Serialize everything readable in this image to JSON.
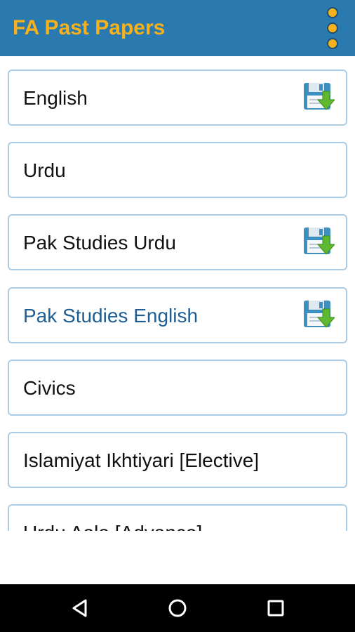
{
  "app": {
    "title": "FA Past Papers"
  },
  "appbar": {
    "menu_icon": "more-vert-icon",
    "accent": "#f7b21b",
    "background": "#2a7ab0"
  },
  "list": {
    "items": [
      {
        "label": "English",
        "downloaded": true,
        "icon": "save-download-icon"
      },
      {
        "label": "Urdu",
        "downloaded": false
      },
      {
        "label": "Pak Studies Urdu",
        "downloaded": true,
        "icon": "save-download-icon"
      },
      {
        "label": "Pak Studies English",
        "downloaded": true,
        "icon": "save-download-icon",
        "highlighted": true
      },
      {
        "label": "Civics",
        "downloaded": false
      },
      {
        "label": "Islamiyat Ikhtiyari [Elective]",
        "downloaded": false
      },
      {
        "label": "Urdu Aala [Advance]",
        "downloaded": false
      }
    ]
  },
  "navbar": {
    "icons": [
      "back-icon",
      "home-icon",
      "recents-icon"
    ]
  }
}
